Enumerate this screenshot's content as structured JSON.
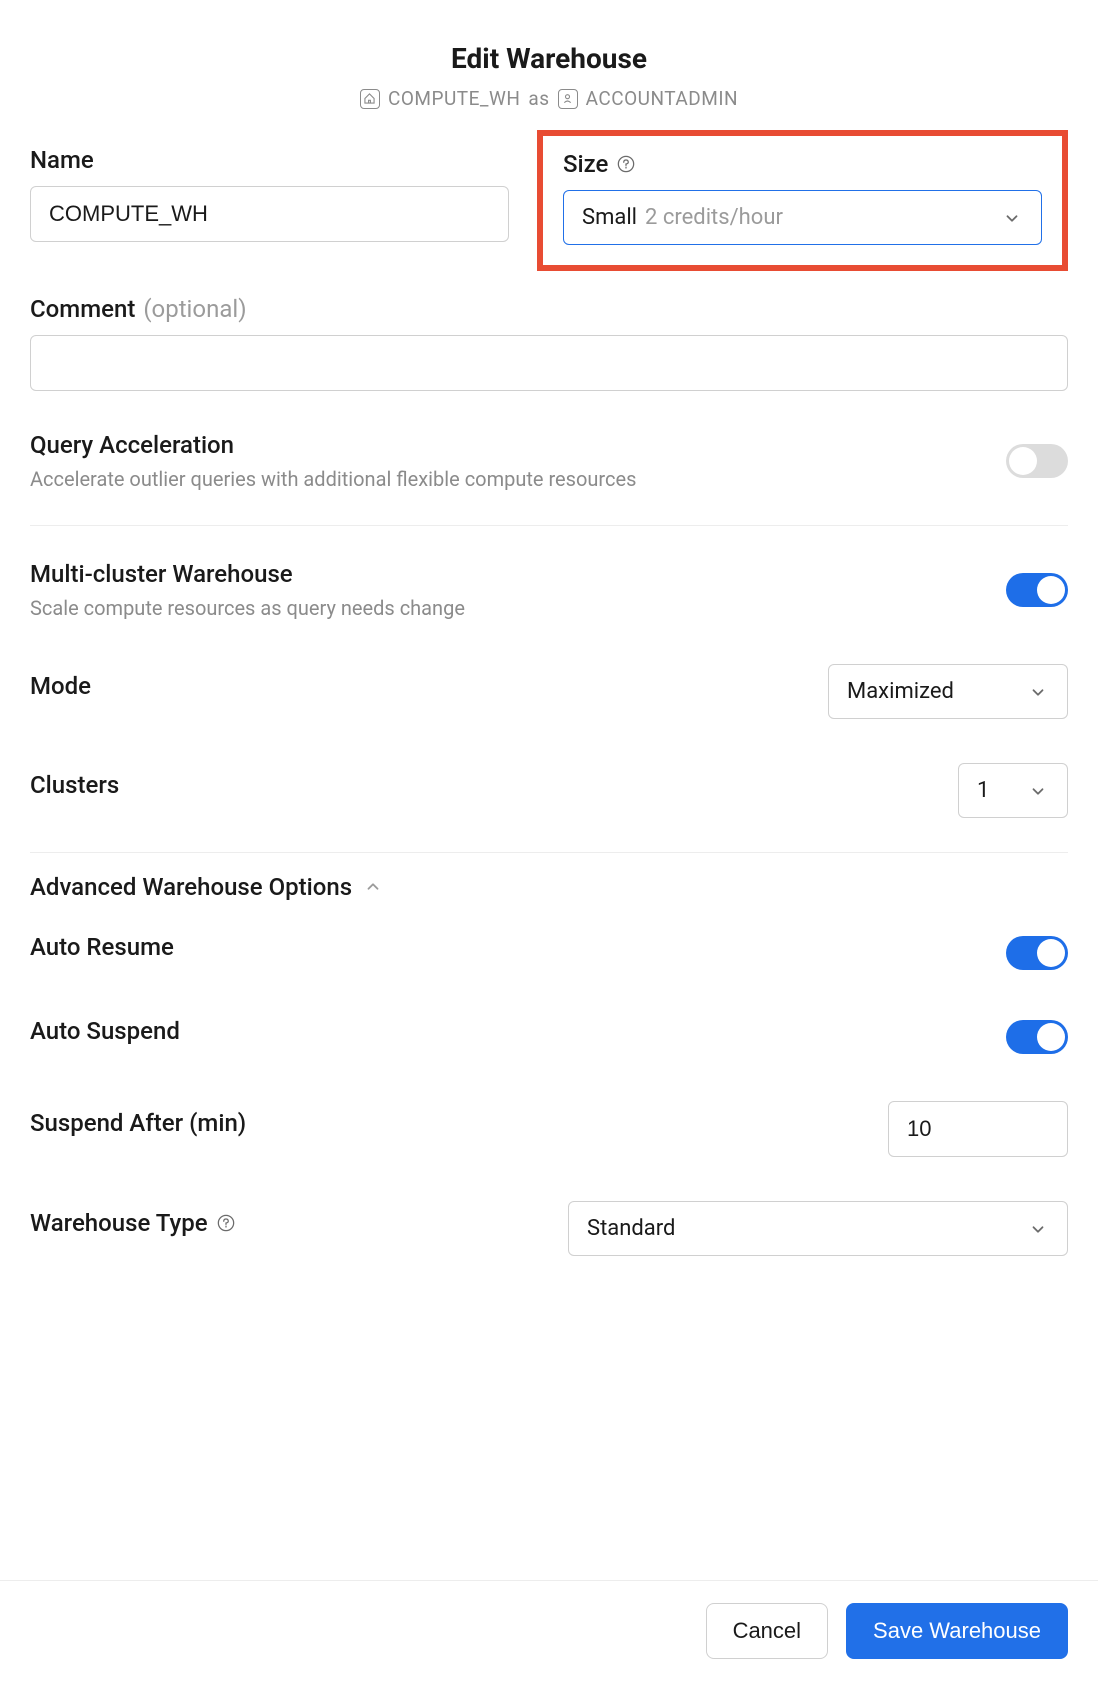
{
  "header": {
    "title": "Edit Warehouse",
    "context_warehouse": "COMPUTE_WH",
    "context_as": "as",
    "context_role": "ACCOUNTADMIN"
  },
  "fields": {
    "name": {
      "label": "Name",
      "value": "COMPUTE_WH"
    },
    "size": {
      "label": "Size",
      "value": "Small",
      "hint": "2 credits/hour"
    },
    "comment": {
      "label": "Comment",
      "optional": "(optional)",
      "value": ""
    },
    "query_accel": {
      "label": "Query Acceleration",
      "subtitle": "Accelerate outlier queries with additional flexible compute resources",
      "enabled": false
    },
    "multi_cluster": {
      "label": "Multi-cluster Warehouse",
      "subtitle": "Scale compute resources as query needs change",
      "enabled": true
    },
    "mode": {
      "label": "Mode",
      "value": "Maximized"
    },
    "clusters": {
      "label": "Clusters",
      "value": "1"
    },
    "advanced_label": "Advanced Warehouse Options",
    "auto_resume": {
      "label": "Auto Resume",
      "enabled": true
    },
    "auto_suspend": {
      "label": "Auto Suspend",
      "enabled": true
    },
    "suspend_after": {
      "label": "Suspend After (min)",
      "value": "10"
    },
    "warehouse_type": {
      "label": "Warehouse Type",
      "value": "Standard"
    }
  },
  "footer": {
    "cancel": "Cancel",
    "save": "Save Warehouse"
  }
}
